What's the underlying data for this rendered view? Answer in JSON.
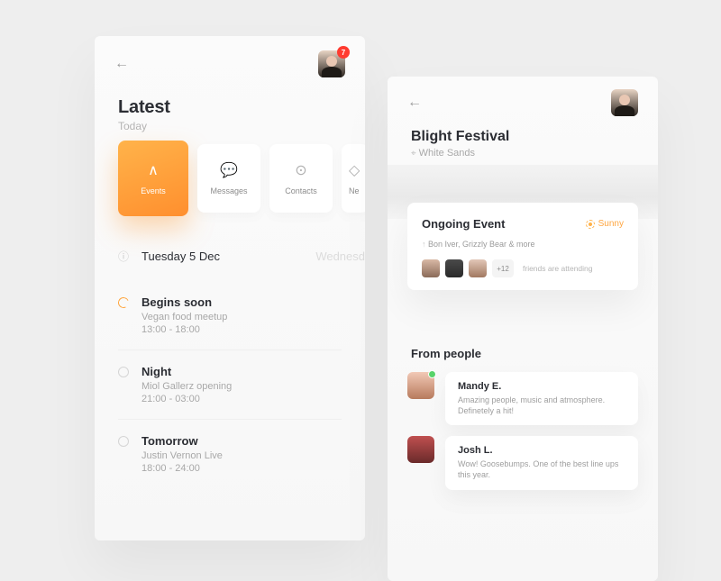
{
  "left": {
    "badge": "7",
    "title": "Latest",
    "subtitle": "Today",
    "tabs": [
      "Events",
      "Messages",
      "Contacts",
      "Ne"
    ],
    "date": "Tuesday 5 Dec",
    "next_date": "Wednesd",
    "events": [
      {
        "label": "Begins soon",
        "desc": "Vegan food meetup",
        "time": "13:00 - 18:00",
        "soon": true
      },
      {
        "label": "Night",
        "desc": "Miol Gallerz opening",
        "time": "21:00 - 03:00",
        "soon": false
      },
      {
        "label": "Tomorrow",
        "desc": "Justin Vernon Live",
        "time": "18:00 - 24:00",
        "soon": false
      }
    ]
  },
  "right": {
    "title": "Blight Festival",
    "location": "White Sands",
    "card": {
      "heading": "Ongoing Event",
      "weather": "Sunny",
      "lineup": "Bon Iver, Grizzly Bear & more",
      "plus": "+12",
      "attending": "friends are attending"
    },
    "from": "From people",
    "reviews": [
      {
        "name": "Mandy E.",
        "text": "Amazing people, music and atmosphere. Definetely a hit!",
        "online": true
      },
      {
        "name": "Josh L.",
        "text": "Wow! Goosebumps. One of the best line ups this year.",
        "online": false
      }
    ]
  }
}
